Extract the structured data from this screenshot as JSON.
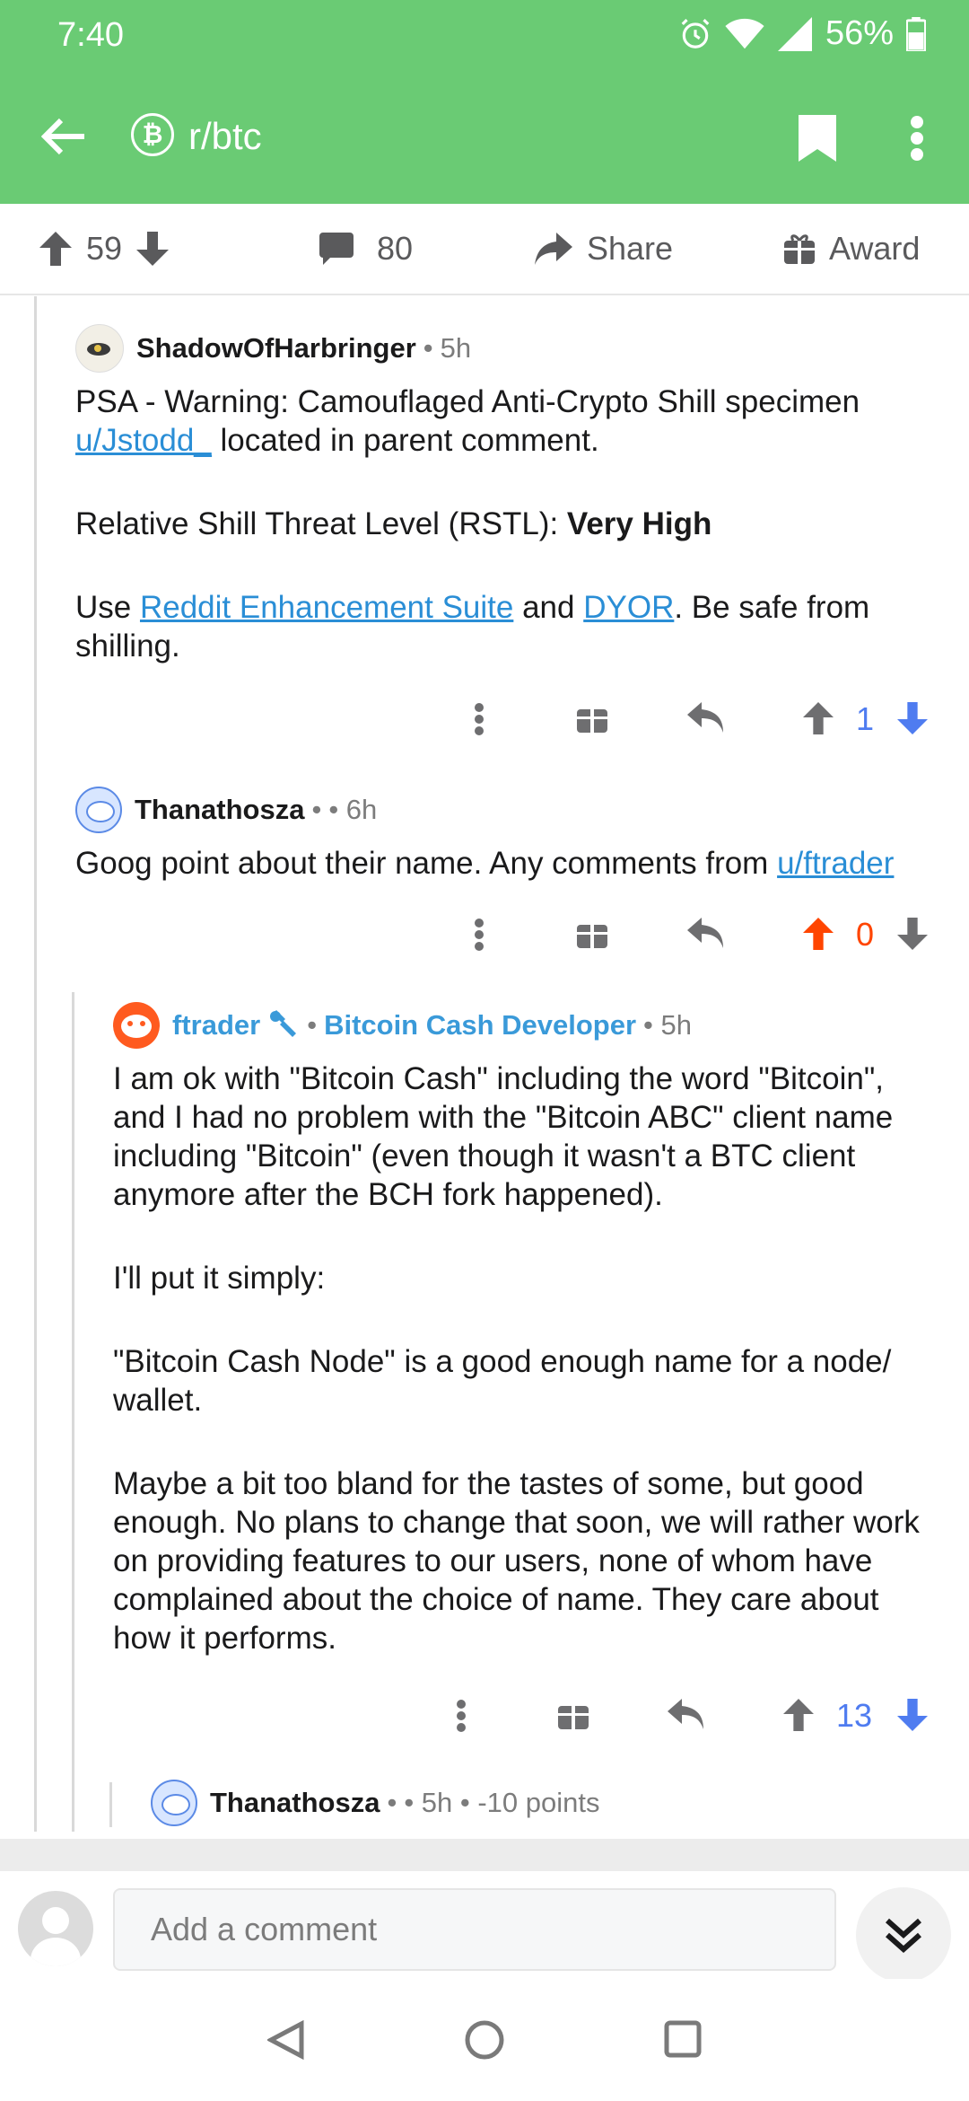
{
  "status_bar": {
    "time": "7:40",
    "battery": "56%"
  },
  "app_bar": {
    "subreddit": "r/btc"
  },
  "post_actions": {
    "upvotes": "59",
    "comments": "80",
    "share": "Share",
    "award": "Award"
  },
  "comments": [
    {
      "author": "ShadowOfHarbringer",
      "sep": "•",
      "age": "5h",
      "body": {
        "p1_a": "PSA - Warning: Camouflaged Anti-Crypto Shill specimen ",
        "p1_link": "u/Jstodd_",
        "p1_b": " located in parent comment.",
        "p2_a": "Relative Shill Threat Level (RSTL): ",
        "p2_bold": "Very High",
        "p3_a": "Use ",
        "p3_link1": "Reddit Enhancement Suite",
        "p3_b": " and ",
        "p3_link2": "DYOR",
        "p3_c": ". Be safe from shilling."
      },
      "score": "1"
    },
    {
      "author": "Thanathosza",
      "sep": "•",
      "age": "• 6h",
      "body": {
        "text": "Goog point about their name. Any comments from ",
        "link": "u/ftrader"
      },
      "score": "0"
    },
    {
      "author": "ftrader",
      "sep": "•",
      "flair": "Bitcoin Cash Developer",
      "age": "• 5h",
      "body": {
        "p1": "I am ok with \"Bitcoin Cash\" including the word \"Bitcoin\", and I had no problem with the \"Bitcoin ABC\" client name including \"Bitcoin\" (even though it wasn't a BTC client anymore after the BCH fork happened).",
        "p2": "I'll put it simply:",
        "p3": "\"Bitcoin Cash Node\" is a good enough name for a node/ wallet.",
        "p4": "Maybe a bit too bland for the tastes of some, but good enough. No plans to change that soon, we will rather work on providing features to our  users, none of whom have complained about the choice of name. They care about how it performs."
      },
      "score": "13"
    },
    {
      "author": "Thanathosza",
      "sep": "•",
      "meta": "• 5h • -10 points"
    }
  ],
  "composer": {
    "placeholder": "Add a comment"
  },
  "colors": {
    "brand_green": "#6acb74",
    "upvote_orange": "#ff4500",
    "vote_blue": "#4f7cf0",
    "link_blue": "#2a8ed6"
  },
  "icons": [
    "back-arrow-icon",
    "bitcoin-icon",
    "bookmark-icon",
    "more-vert-icon",
    "upvote-icon",
    "downvote-icon",
    "comment-icon",
    "share-icon",
    "gift-icon",
    "reply-icon",
    "wrench-icon",
    "collapse-icon",
    "back-nav-icon",
    "home-nav-icon",
    "recents-nav-icon"
  ]
}
